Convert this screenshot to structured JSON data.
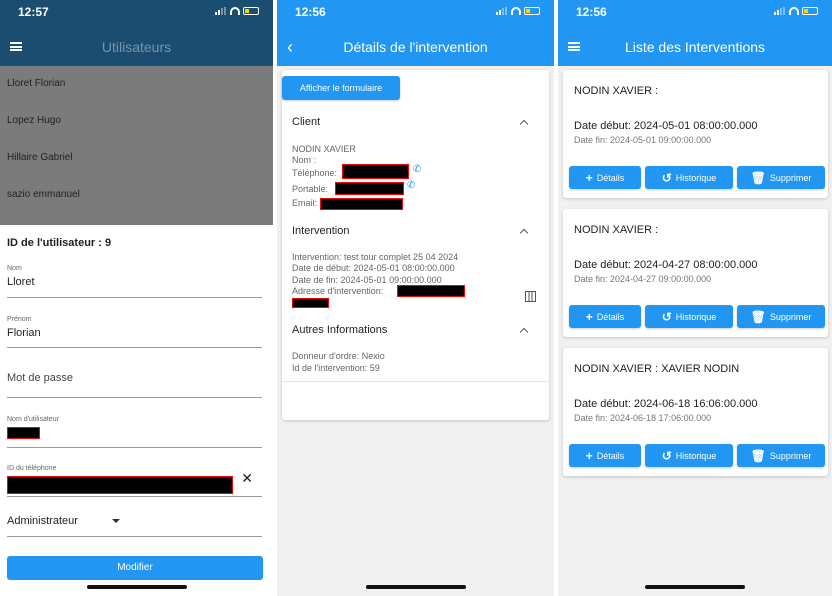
{
  "status_times": [
    "12:57",
    "12:56",
    "12:56"
  ],
  "screen1": {
    "title": "Utilisateurs",
    "users": [
      "Lloret Florian",
      "Lopez Hugo",
      "Hillaire Gabriel",
      "sazio emmanuel"
    ],
    "user_id_label": "ID de l'utilisateur : 9",
    "nom_label": "Nom",
    "nom_value": "Lloret",
    "prenom_label": "Prénom",
    "prenom_value": "Florian",
    "password_placeholder": "Mot de passe",
    "username_label": "Nom d'utilisateur",
    "phone_id_label": "ID du téléphone",
    "clear_symbol": "✕",
    "role_value": "Administrateur",
    "submit_label": "Modifier"
  },
  "screen2": {
    "title": "Détails de l'intervention",
    "show_form_label": "Afficher le formulaire",
    "client_section": "Client",
    "client_name": "NODIN XAVIER",
    "nom_line": "Nom :",
    "telephone_line": "Téléphone:",
    "portable_line": "Portable:",
    "email_line": "Email:",
    "intervention_section": "Intervention",
    "intervention_label": "Intervention: test tour complet 25 04 2024",
    "date_debut": "Date de début: 2024-05-01 08:00:00.000",
    "date_fin": "Date de fin: 2024-05-01 09:00:00.000",
    "adresse_label": "Adresse d'intervention:",
    "autres_section": "Autres Informations",
    "donneur": "Donneur d'ordre: Nexio",
    "id_intervention": "Id de l'intervention: 59"
  },
  "screen3": {
    "title": "Liste des Interventions",
    "buttons": {
      "details": "Détails",
      "historique": "Historique",
      "supprimer": "Supprimer"
    },
    "interventions": [
      {
        "name": "NODIN XAVIER :",
        "start": "Date début: 2024-05-01 08:00:00.000",
        "end": "Date fin: 2024-05-01 09:00:00.000"
      },
      {
        "name": "NODIN XAVIER :",
        "start": "Date début: 2024-04-27 08:00:00.000",
        "end": "Date fin: 2024-04-27 09:00:00.000"
      },
      {
        "name": "NODIN XAVIER : XAVIER NODIN",
        "start": "Date début: 2024-06-18 16:06:00.000",
        "end": "Date fin: 2024-06-18 17:06:00.000"
      }
    ]
  },
  "colors": {
    "primary": "#2196f3",
    "appbar_dimmed": "#1a4d70",
    "redaction_border": "#ff0000"
  }
}
